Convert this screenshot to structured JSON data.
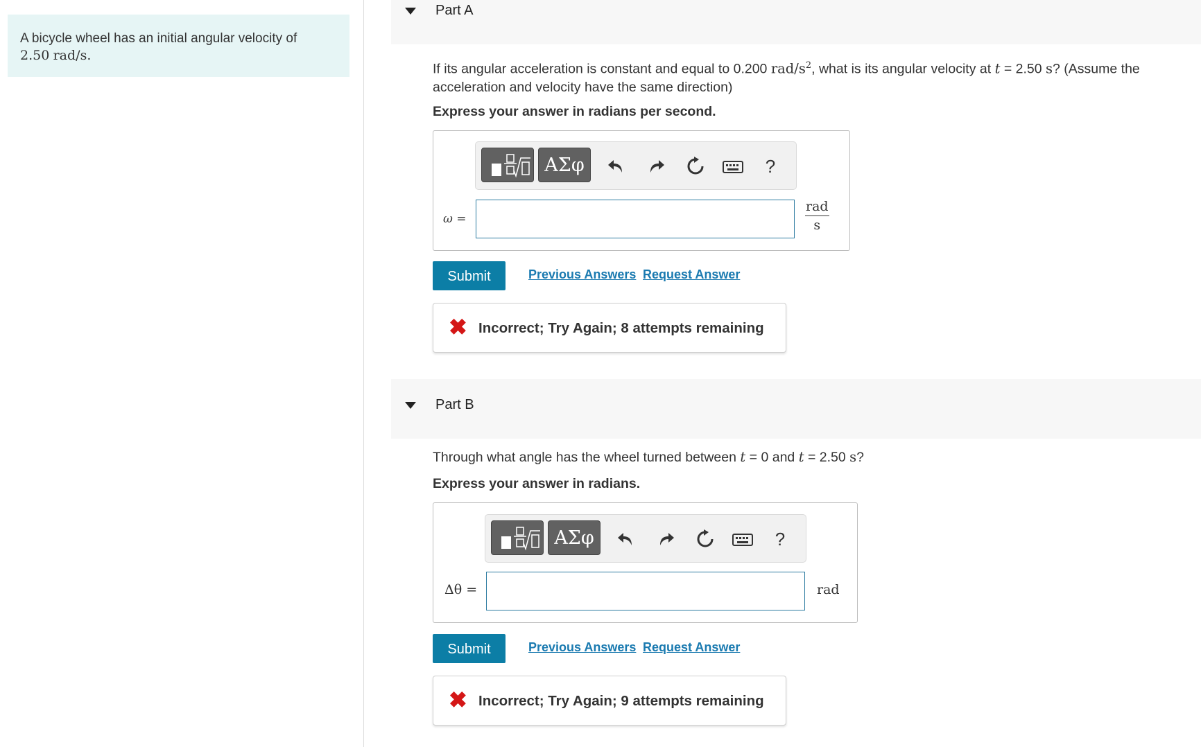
{
  "problem": {
    "text": "A bicycle wheel has an initial angular velocity of",
    "value": "2.50",
    "unit": "rad/s."
  },
  "toolbar": {
    "greek_label": "ΑΣφ",
    "help_label": "?"
  },
  "parts": [
    {
      "title": "Part A",
      "question": {
        "pre": "If its angular acceleration is constant and equal to 0.200 ",
        "unit1": "rad/s",
        "sup": "2",
        "mid": ", what is its angular velocity at ",
        "var": "t",
        "eq": " = 2.50 ",
        "unit2": "s",
        "post": "? (Assume the acceleration and velocity have the same direction)"
      },
      "instruction": "Express your answer in radians per second.",
      "field_label": "ω =",
      "unit_num": "rad",
      "unit_den": "s",
      "submit_label": "Submit",
      "previous_label": "Previous Answers",
      "request_label": "Request Answer",
      "feedback": "Incorrect; Try Again; 8 attempts remaining"
    },
    {
      "title": "Part B",
      "question": {
        "pre": "Through what angle has the wheel turned between ",
        "var1": "t",
        "mid": " = 0 and ",
        "var2": "t",
        "eq": " = 2.50 ",
        "unit": "s",
        "post": "?"
      },
      "instruction": "Express your answer in radians.",
      "field_label": "Δθ =",
      "unit": "rad",
      "submit_label": "Submit",
      "previous_label": "Previous Answers",
      "request_label": "Request Answer",
      "feedback": "Incorrect; Try Again; 9 attempts remaining"
    }
  ],
  "colors": {
    "accent": "#0c7ea6",
    "link": "#1a7ab0",
    "error": "#d41616",
    "problem_bg": "#e6f5f5"
  }
}
